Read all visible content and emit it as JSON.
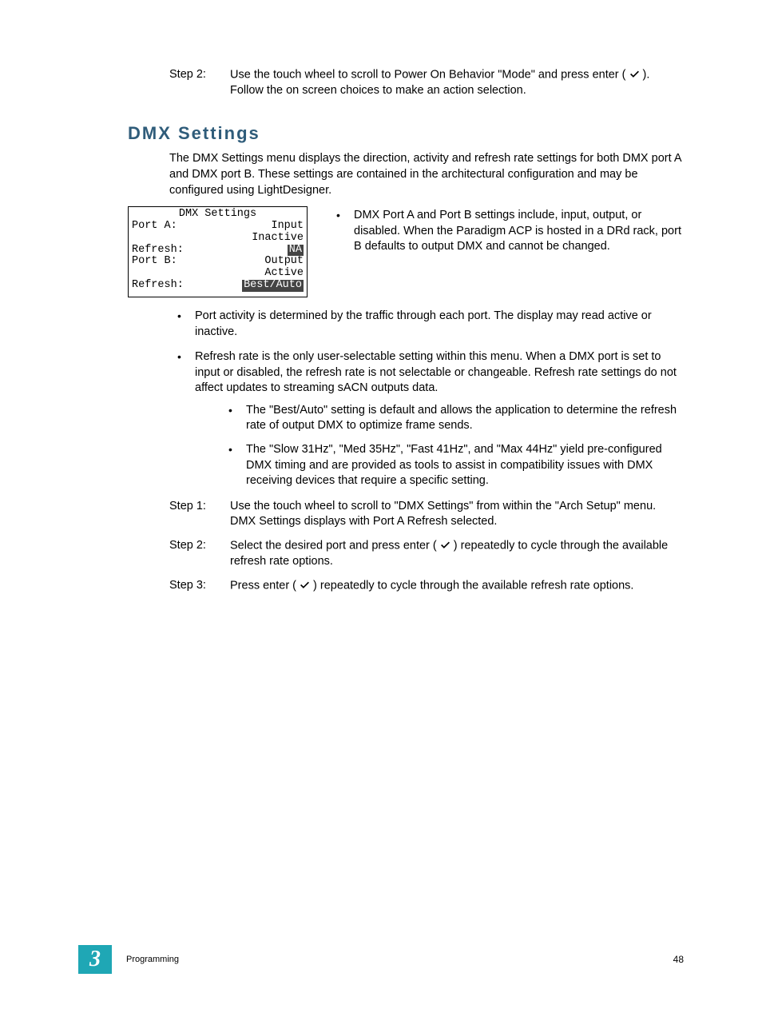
{
  "top_step": {
    "label": "Step 2:",
    "text_before": "Use the touch wheel to scroll to Power On Behavior \"Mode\" and press enter ( ",
    "text_after": " ). Follow the on screen choices to make an action selection."
  },
  "heading": "DMX Settings",
  "intro": "The DMX Settings menu displays the direction, activity and refresh rate settings for both DMX port A and DMX port B. These settings are contained in the architectural configuration and may be configured using LightDesigner.",
  "lcd": {
    "title": "DMX Settings",
    "rows": [
      {
        "left": "Port A:",
        "right": "Input",
        "hl": false
      },
      {
        "left": "",
        "right": "Inactive",
        "hl": false
      },
      {
        "left": "Refresh:",
        "right": "NA",
        "hl": true
      },
      {
        "left": "Port B:",
        "right": "Output",
        "hl": false
      },
      {
        "left": "",
        "right": "Active",
        "hl": false
      },
      {
        "left": "Refresh:",
        "right": "Best/Auto",
        "hl": true
      }
    ]
  },
  "side_bullet": "DMX Port A and Port B settings include, input, output, or disabled. When the Paradigm ACP is hosted in a DRd rack, port B defaults to output DMX and cannot be changed.",
  "bullets": [
    {
      "text": "Port activity is determined by the traffic through each port. The display may read active or inactive."
    },
    {
      "text": "Refresh rate is the only user-selectable setting within this menu. When a DMX port is set to input or disabled, the refresh rate is not selectable or changeable. Refresh rate settings do not affect updates to streaming sACN outputs data.",
      "sub": [
        "The \"Best/Auto\" setting is default and allows the application to determine the refresh rate of output DMX to optimize frame sends.",
        "The \"Slow 31Hz\", \"Med 35Hz\", \"Fast 41Hz\", and \"Max 44Hz\" yield pre-configured DMX timing and are provided as tools to assist in compatibility issues with DMX receiving devices that require a specific setting."
      ]
    }
  ],
  "steps": [
    {
      "label": "Step 1:",
      "text": "Use the touch wheel to scroll to \"DMX Settings\" from within the \"Arch Setup\" menu. DMX Settings displays with Port A Refresh selected."
    },
    {
      "label": "Step 2:",
      "before": "Select the desired port and press enter ( ",
      "after": " ) repeatedly to cycle through the available refresh rate options."
    },
    {
      "label": "Step 3:",
      "before": "Press enter ( ",
      "after": " ) repeatedly to cycle through the available refresh rate options."
    }
  ],
  "footer": {
    "chapter": "3",
    "section": "Programming",
    "page": "48"
  }
}
